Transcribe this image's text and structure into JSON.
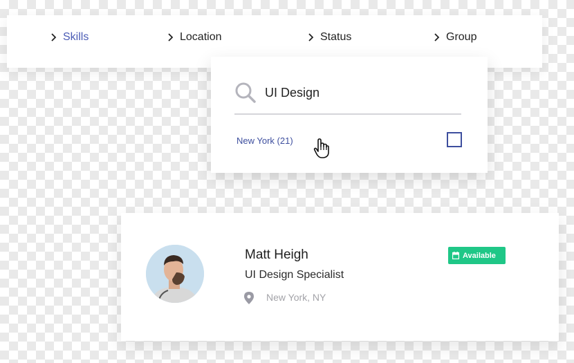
{
  "filter_bar": {
    "items": [
      {
        "label": "Skills",
        "active": true
      },
      {
        "label": "Location",
        "active": false
      },
      {
        "label": "Status",
        "active": false
      },
      {
        "label": "Group",
        "active": false
      }
    ]
  },
  "dropdown": {
    "search_value": "UI Design",
    "option": {
      "label": "New York (21)",
      "checked": false
    }
  },
  "profile": {
    "name": "Matt Heigh",
    "title": "UI Design Specialist",
    "location": "New York, NY",
    "badge": "Available"
  },
  "colors": {
    "accent": "#4a5bb5",
    "badge": "#1fc787",
    "muted": "#a3a3a8"
  },
  "icons": [
    "chevron-right-icon",
    "search-icon",
    "hand-cursor-icon",
    "map-pin-icon",
    "calendar-icon"
  ]
}
